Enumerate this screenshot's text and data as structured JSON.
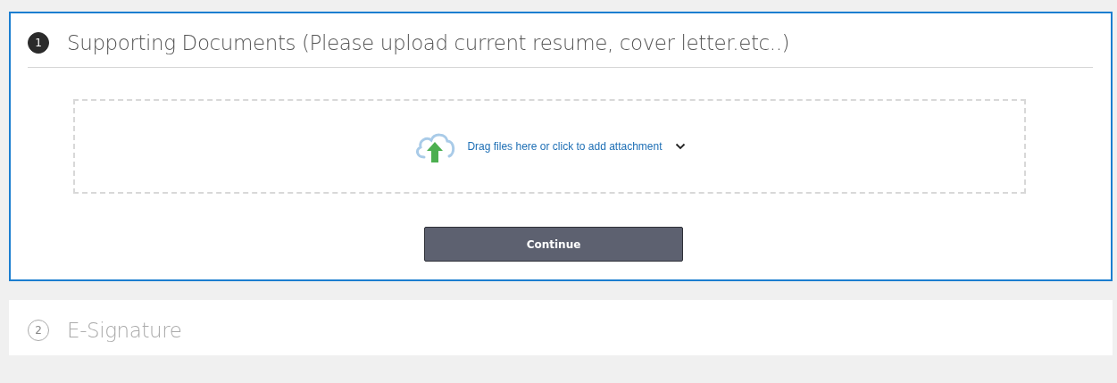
{
  "steps": [
    {
      "number": "1",
      "title": "Supporting Documents (Please upload current resume, cover letter.etc..)",
      "active": true,
      "dropzone": {
        "label": "Drag files here or click to add attachment"
      },
      "button": "Continue"
    },
    {
      "number": "2",
      "title": "E-Signature",
      "active": false
    }
  ]
}
